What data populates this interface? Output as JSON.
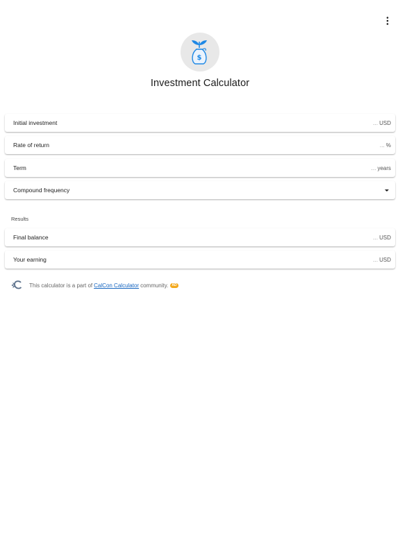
{
  "header": {
    "title": "Investment Calculator",
    "menu_icon": "more-vert-icon",
    "logo_icon": "money-bag-plant-icon"
  },
  "inputs": [
    {
      "label": "Initial investment",
      "value": "...",
      "unit": "USD"
    },
    {
      "label": "Rate of return",
      "value": "...",
      "unit": "%"
    },
    {
      "label": "Term",
      "value": "...",
      "unit": "years"
    }
  ],
  "select": {
    "label": "Compound frequency",
    "icon": "caret-down-icon"
  },
  "results": {
    "label": "Results",
    "items": [
      {
        "label": "Final balance",
        "value": "...",
        "unit": "USD"
      },
      {
        "label": "Your earning",
        "value": "...",
        "unit": "USD"
      }
    ]
  },
  "footer": {
    "prefix": "This calculator is a part of",
    "link": "CalCon Calculator",
    "suffix": "community.",
    "badge": "AD",
    "icon": "calcon-logo-icon"
  },
  "colors": {
    "accent": "#1e88e5",
    "link": "#1565c0",
    "badge": "#f3a81b"
  }
}
